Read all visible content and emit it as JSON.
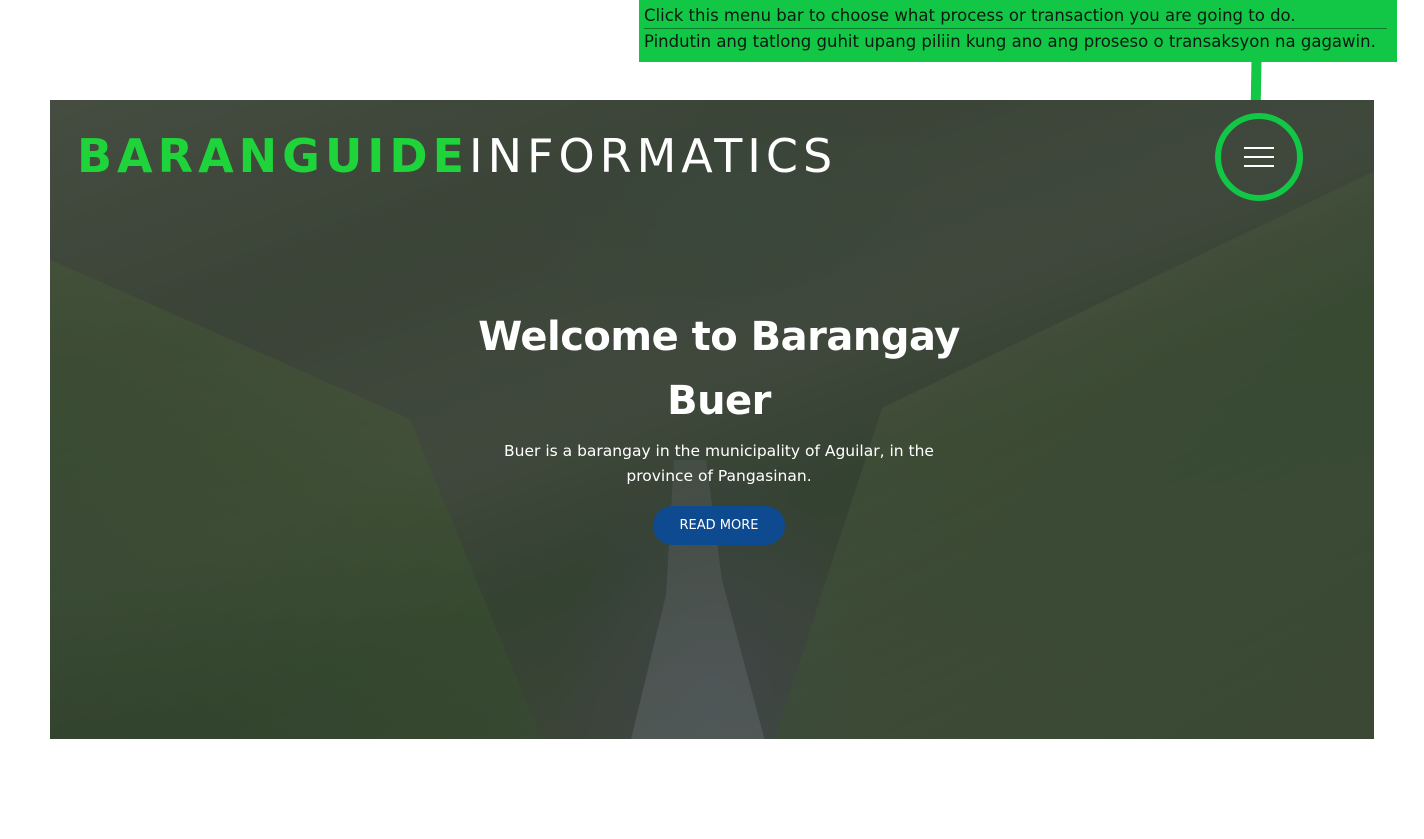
{
  "callout": {
    "line_en": "Click this menu bar to choose what process or transaction you are going to do.",
    "line_fil": "Pindutin ang tatlong guhit upang piliin kung ano ang proseso o transaksyon na gagawin.",
    "color": "#12c745"
  },
  "header": {
    "brand_primary": "BARANGUIDE",
    "brand_secondary": "INFORMATICS",
    "brand_primary_color": "#1ed43a",
    "menu_icon": "hamburger-menu-icon"
  },
  "hero": {
    "title_line1": "Welcome to Barangay",
    "title_line2": "Buer",
    "subtitle": "Buer is a barangay in the municipality of Aguilar, in the province of Pangasinan.",
    "cta_label": "READ MORE",
    "cta_color": "#0d4a8f"
  }
}
